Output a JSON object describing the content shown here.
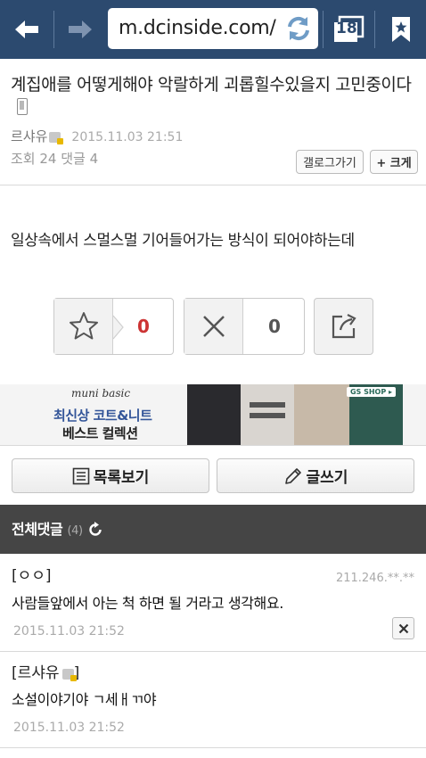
{
  "browser": {
    "url": "m.dcinside.com/",
    "tab_count": "18"
  },
  "post": {
    "title": "계집애를 어떻게해야 악랄하게 괴롭힐수있을지 고민중이다",
    "author": "르샤유",
    "date": "2015.11.03 21:51",
    "stats": "조회 24 댓글 4",
    "gallery_button": "갤로그가기",
    "size_button": "+ 크게",
    "body": "일상속에서 스멀스멀 기어들어가는 방식이 되어야하는데"
  },
  "vote": {
    "up_count": "0",
    "down_count": "0",
    "up_color": "#cc3333"
  },
  "ad": {
    "brand": "muni basic",
    "line1": "최신상 코트&니트",
    "line2": "베스트 컬렉션",
    "shop_tag": "GS SHOP ▸"
  },
  "actions": {
    "list_label": "목록보기",
    "write_label": "글쓰기"
  },
  "comments": {
    "header": "전체댓글",
    "count": "(4)",
    "items": [
      {
        "name": "[ㅇㅇ]",
        "ip": "211.246.**.**",
        "text": "사람들앞에서 아는 척 하면 될 거라고 생각해요.",
        "date": "2015.11.03 21:52"
      },
      {
        "name": "[르샤유",
        "name_end": "]",
        "text": "소설이야기야 ㄱ세ㅐㄲ야",
        "date": "2015.11.03 21:52"
      }
    ]
  },
  "colors": {
    "toolbar": "#2c4a6f",
    "comment_header": "#454545"
  }
}
